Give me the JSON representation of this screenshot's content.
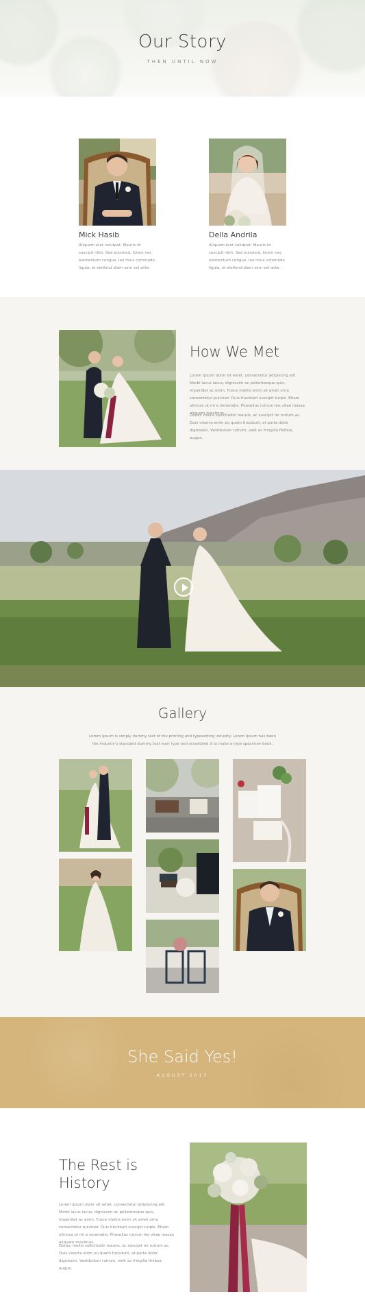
{
  "hero": {
    "title": "Our Story",
    "subtitle": "THEN UNTIL NOW"
  },
  "couple": [
    {
      "name": "Mick Hasib",
      "bio": "Aliquam erat volutpat. Mauris id suscipit nibh. Sed euismod, lorem nec elementum congue, leo risus commodo ligula, et eleifend diam sem vel ante."
    },
    {
      "name": "Della Andrila",
      "bio": "Aliquam erat volutpat. Mauris id suscipit nibh. Sed euismod, lorem nec elementum congue, leo risus commodo ligula, et eleifend diam sem vel ante."
    }
  ],
  "met": {
    "title": "How We Met",
    "p1": "Lorem ipsum dolor sit amet, consectetur adipiscing elit. Morbi lacus lacus, dignissim ac pellentesque quis, imperdiet ac enim. Fusce mattis enim sit amet urna consectetur pulvinar. Duis tincidunt suscipit turpis. Etiam ultrices ut mi a venenatis. Phasellus rutrum leo vitae massa aliquam maximus.",
    "p2": "Donec mollis sollicitudin mauris, ac suscipit mi rutrum ac. Duis viverra enim eu quam tincidunt, at porta dolor dignissim. Vestibulum rutrum, velit ac fringilla finibus, augue."
  },
  "video": {
    "play_icon": "play-icon"
  },
  "gallery": {
    "title": "Gallery",
    "desc": "Lorem Ipsum is simply dummy text of the printing and typesetting industry. Lorem Ipsum has been the industry's standard dummy text ever type and scrambled it to make a type specimen book."
  },
  "yes": {
    "title": "She Said Yes!",
    "subtitle": "AUGUST 2017",
    "bg_color": "#d5b57c"
  },
  "rest": {
    "title": "The Rest is History",
    "p1": "Lorem ipsum dolor sit amet, consectetur adipiscing elit. Morbi lacus lacus, dignissim ac pellentesque quis, imperdiet ac enim. Fusce mattis enim sit amet urna consectetur pulvinar. Duis tincidunt suscipit turpis. Etiam ultrices ut mi a venenatis. Phasellus rutrum leo vitae massa aliquam maximus.",
    "p2": "Donec mollis sollicitudin mauris, ac suscipit mi rutrum ac. Duis viverra enim eu quam tincidunt, at porta dolor dignissim. Vestibulum rutrum, velit ac fringilla finibus, augue."
  }
}
